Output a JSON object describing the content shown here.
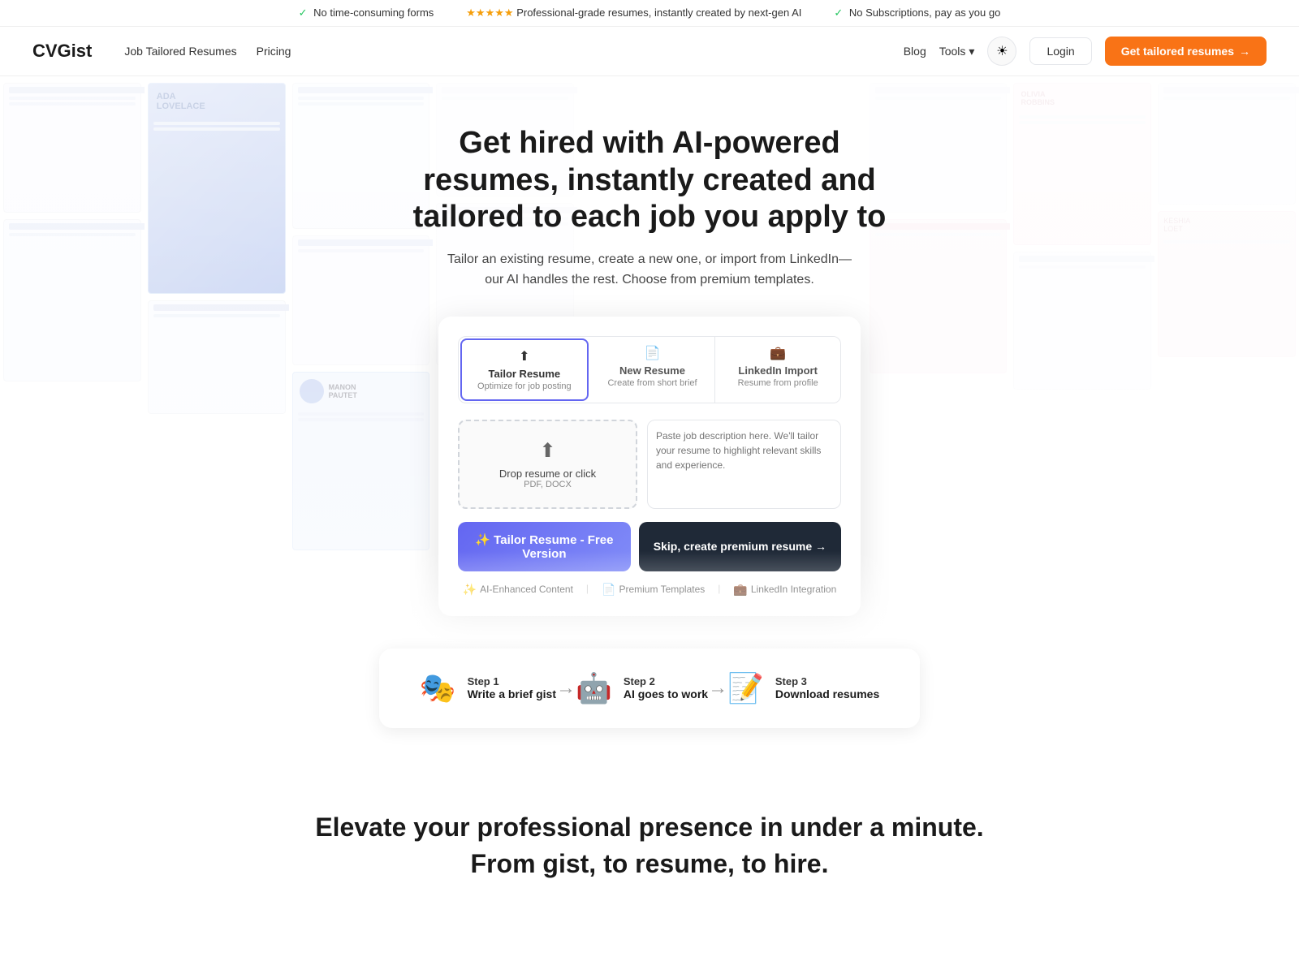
{
  "topBanner": {
    "item1": "No time-consuming forms",
    "stars": "★★★★★",
    "item2": "Professional-grade resumes, instantly created by next-gen AI",
    "item3": "No Subscriptions, pay as you go"
  },
  "navbar": {
    "logo": "CVGist",
    "navLinks": [
      {
        "label": "Job Tailored Resumes",
        "id": "nav-tailored"
      },
      {
        "label": "Pricing",
        "id": "nav-pricing"
      }
    ],
    "blogLabel": "Blog",
    "toolsLabel": "Tools",
    "toolsChevron": "▾",
    "themeIcon": "☀",
    "loginLabel": "Login",
    "ctaLabel": "Get tailored resumes",
    "ctaArrow": "→"
  },
  "hero": {
    "title": "Get hired with AI-powered resumes, instantly created and tailored to each job you apply to",
    "subtitle": "Tailor an existing resume, create a new one, or import from LinkedIn—our AI handles the rest. Choose from premium templates."
  },
  "card": {
    "tabs": [
      {
        "id": "tailor",
        "icon": "↑",
        "title": "Tailor Resume",
        "sub": "Optimize for job posting",
        "active": true
      },
      {
        "id": "new",
        "icon": "📄",
        "title": "New Resume",
        "sub": "Create from short brief",
        "active": false
      },
      {
        "id": "linkedin",
        "icon": "💼",
        "title": "LinkedIn Import",
        "sub": "Resume from profile",
        "active": false
      }
    ],
    "dropZone": {
      "icon": "↑",
      "label": "Drop resume or click",
      "sub": "PDF, DOCX"
    },
    "jobDescPlaceholder": "Paste job description here. We'll tailor your resume to highlight relevant skills and experience.",
    "tailorFreeBtn": "✨ Tailor Resume - Free Version",
    "skipPremiumBtn": "Skip, create premium resume →",
    "features": [
      {
        "icon": "✨",
        "label": "AI-Enhanced Content"
      },
      {
        "icon": "📄",
        "label": "Premium Templates"
      },
      {
        "icon": "💼",
        "label": "LinkedIn Integration"
      }
    ]
  },
  "steps": [
    {
      "icon": "🎭",
      "label": "Step 1",
      "desc": "Write a brief gist"
    },
    {
      "icon": "🤖",
      "label": "Step 2",
      "desc": "AI goes to work"
    },
    {
      "icon": "📝",
      "label": "Step 3",
      "desc": "Download resumes"
    }
  ],
  "bottomSection": {
    "title": "Elevate your professional presence in under a minute.\nFrom gist, to resume, to hire."
  }
}
